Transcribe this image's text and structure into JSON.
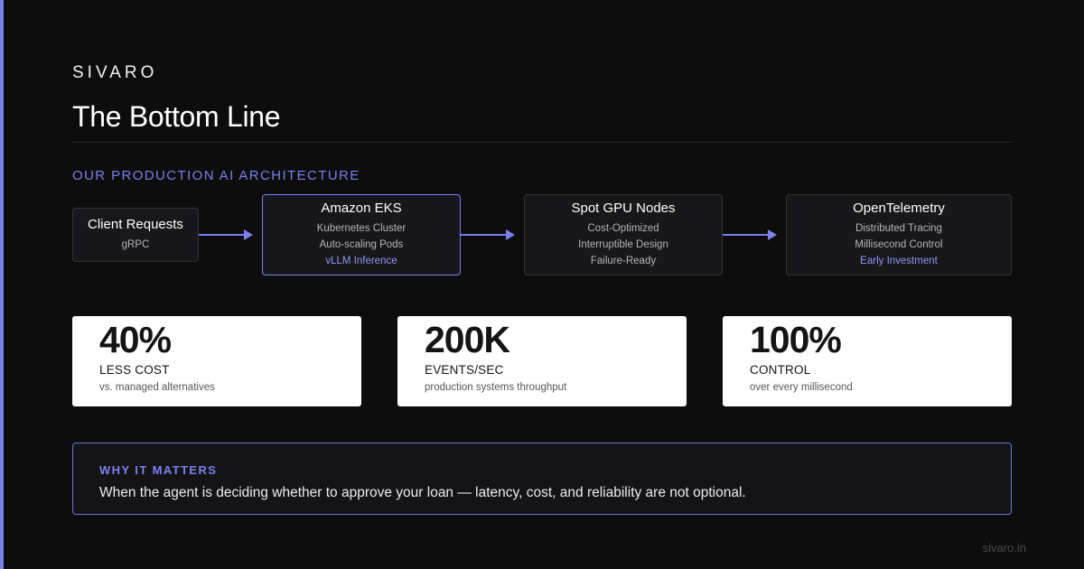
{
  "brand": "SIVARO",
  "title": "The Bottom Line",
  "section_label": "OUR PRODUCTION AI ARCHITECTURE",
  "nodes": [
    {
      "title": "Client Requests",
      "lines": [
        "gRPC"
      ]
    },
    {
      "title": "Amazon EKS",
      "lines": [
        "Kubernetes Cluster",
        "Auto-scaling Pods",
        "vLLM Inference"
      ]
    },
    {
      "title": "Spot GPU Nodes",
      "lines": [
        "Cost-Optimized",
        "Interruptible Design",
        "Failure-Ready"
      ]
    },
    {
      "title": "OpenTelemetry",
      "lines": [
        "Distributed Tracing",
        "Millisecond Control",
        "Early Investment"
      ]
    }
  ],
  "stats": [
    {
      "value": "40%",
      "label": "LESS COST",
      "sub": "vs. managed alternatives"
    },
    {
      "value": "200K",
      "label": "EVENTS/SEC",
      "sub": "production systems throughput"
    },
    {
      "value": "100%",
      "label": "CONTROL",
      "sub": "over every millisecond"
    }
  ],
  "why": {
    "label": "WHY IT MATTERS",
    "text": "When the agent is deciding whether to approve your loan — latency, cost, and reliability are not optional."
  },
  "footer": "sivaro.in",
  "colors": {
    "accent": "#7b80ee",
    "background": "#0d0d0e",
    "card": "#ffffff"
  }
}
